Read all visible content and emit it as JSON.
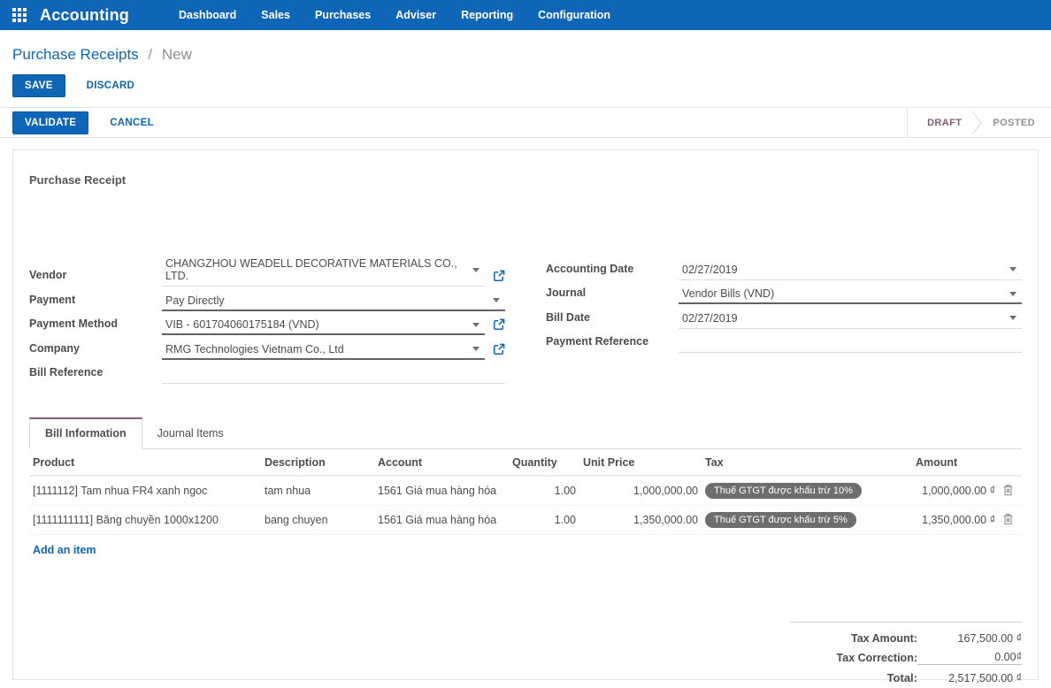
{
  "nav": {
    "brand": "Accounting",
    "items": [
      {
        "label": "Dashboard"
      },
      {
        "label": "Sales"
      },
      {
        "label": "Purchases"
      },
      {
        "label": "Adviser"
      },
      {
        "label": "Reporting"
      },
      {
        "label": "Configuration"
      }
    ]
  },
  "breadcrumb": {
    "parent": "Purchase Receipts",
    "separator": "/",
    "current": "New"
  },
  "actions": {
    "save": "SAVE",
    "discard": "DISCARD"
  },
  "statusbar": {
    "validate": "VALIDATE",
    "cancel": "CANCEL",
    "states": [
      {
        "label": "DRAFT",
        "active": true
      },
      {
        "label": "POSTED",
        "active": false
      }
    ]
  },
  "sheet": {
    "title": "Purchase Receipt",
    "fields": {
      "vendor": {
        "label": "Vendor",
        "value": "CHANGZHOU WEADELL DECORATIVE MATERIALS CO., LTD."
      },
      "payment": {
        "label": "Payment",
        "value": "Pay Directly"
      },
      "payment_method": {
        "label": "Payment Method",
        "value": "VIB - 601704060175184 (VND)"
      },
      "company": {
        "label": "Company",
        "value": "RMG Technologies Vietnam Co., Ltd"
      },
      "bill_reference": {
        "label": "Bill Reference",
        "value": ""
      },
      "accounting_date": {
        "label": "Accounting Date",
        "value": "02/27/2019"
      },
      "journal": {
        "label": "Journal",
        "value": "Vendor Bills (VND)"
      },
      "bill_date": {
        "label": "Bill Date",
        "value": "02/27/2019"
      },
      "payment_reference": {
        "label": "Payment Reference",
        "value": ""
      }
    },
    "tabs": [
      {
        "label": "Bill Information",
        "active": true
      },
      {
        "label": "Journal Items",
        "active": false
      }
    ],
    "table": {
      "headers": {
        "product": "Product",
        "description": "Description",
        "account": "Account",
        "quantity": "Quantity",
        "unit_price": "Unit Price",
        "tax": "Tax",
        "amount": "Amount"
      },
      "rows": [
        {
          "product": "[1111112] Tam nhua FR4 xanh ngoc",
          "description": "tam nhua",
          "account": "1561 Giá mua hàng hóa",
          "quantity": "1.00",
          "unit_price": "1,000,000.00",
          "tax": "Thuế GTGT được khấu trừ 10%",
          "amount": "1,000,000.00 ₫"
        },
        {
          "product": "[1111111111] Băng chuyền 1000x1200",
          "description": "bang chuyen",
          "account": "1561 Giá mua hàng hóa",
          "quantity": "1.00",
          "unit_price": "1,350,000.00",
          "tax": "Thuế GTGT được khấu trừ 5%",
          "amount": "1,350,000.00 ₫"
        }
      ],
      "add_item": "Add an item"
    },
    "totals": {
      "tax_amount": {
        "label": "Tax Amount:",
        "value": "167,500.00 ₫"
      },
      "tax_correction": {
        "label": "Tax Correction:",
        "value": "0.00₫"
      },
      "total": {
        "label": "Total:",
        "value": "2,517,500.00 ₫"
      }
    }
  },
  "colors": {
    "primary": "#0f66b6",
    "draft_state": "#875a7b",
    "tax_pill": "#6e6e6e"
  }
}
